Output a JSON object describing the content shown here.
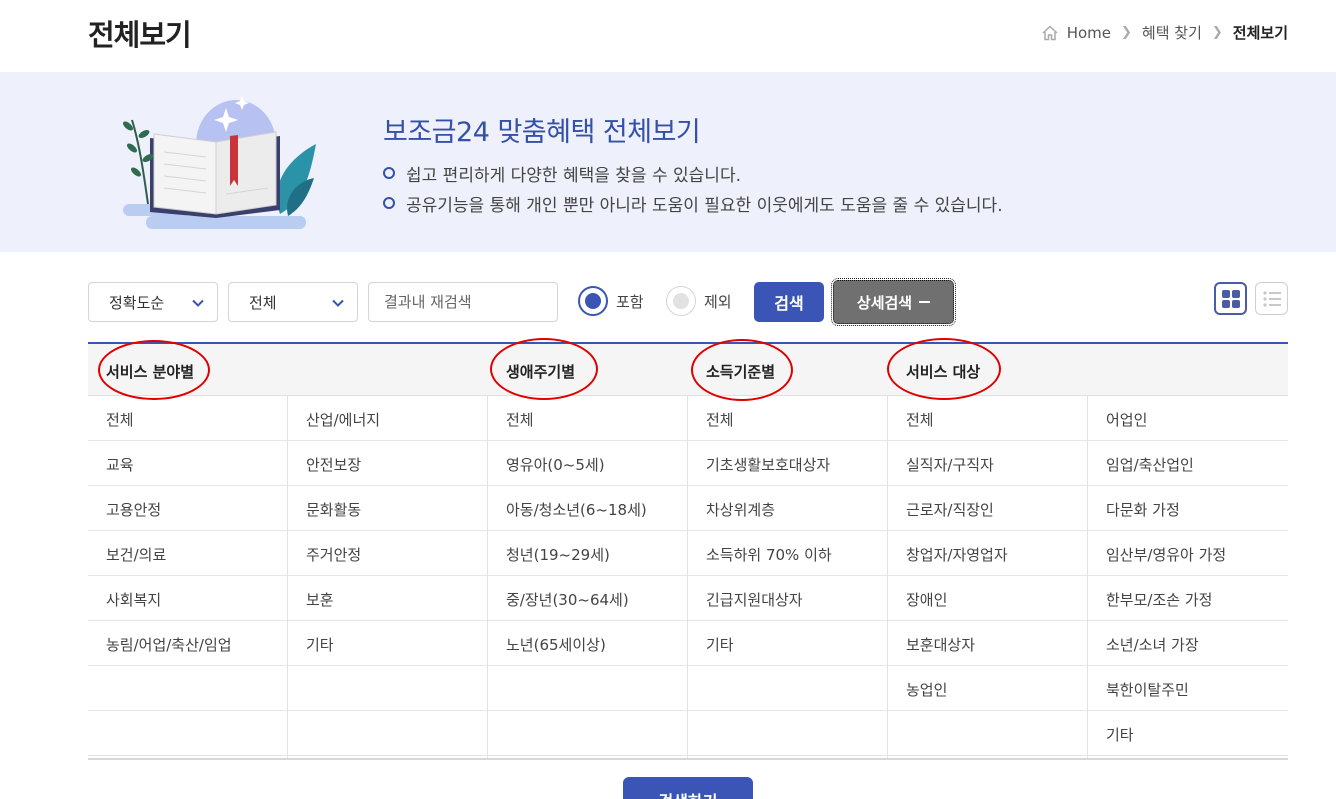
{
  "header": {
    "title": "전체보기",
    "breadcrumb": [
      "Home",
      "혜택 찾기",
      "전체보기"
    ]
  },
  "banner": {
    "title": "보조금24 맞춤혜택 전체보기",
    "bullets": [
      "쉽고 편리하게 다양한 혜택을 찾을 수 있습니다.",
      "공유기능을 통해 개인 뿐만 아니라 도움이 필요한 이웃에게도 도움을 줄 수 있습니다."
    ]
  },
  "search": {
    "sort_value": "정확도순",
    "scope_value": "전체",
    "re_search_placeholder": "결과내 재검색",
    "include_label": "포함",
    "exclude_label": "제외",
    "include_selected": true,
    "search_button": "검색",
    "detail_button": "상세검색"
  },
  "filters": {
    "headers": [
      "서비스 분야별",
      "생애주기별",
      "소득기준별",
      "서비스 대상"
    ],
    "columns": [
      [
        "전체",
        "교육",
        "고용안정",
        "보건/의료",
        "사회복지",
        "농림/어업/축산/임업",
        "",
        ""
      ],
      [
        "산업/에너지",
        "안전보장",
        "문화활동",
        "주거안정",
        "보훈",
        "기타",
        "",
        ""
      ],
      [
        "전체",
        "영유아(0~5세)",
        "아동/청소년(6~18세)",
        "청년(19~29세)",
        "중/장년(30~64세)",
        "노년(65세이상)",
        "",
        ""
      ],
      [
        "전체",
        "기초생활보호대상자",
        "차상위계층",
        "소득하위 70% 이하",
        "긴급지원대상자",
        "기타",
        "",
        ""
      ],
      [
        "전체",
        "실직자/구직자",
        "근로자/직장인",
        "창업자/자영업자",
        "장애인",
        "보훈대상자",
        "농업인",
        ""
      ],
      [
        "어업인",
        "임업/축산업인",
        "다문화 가정",
        "임산부/영유아 가정",
        "한부모/조손 가정",
        "소년/소녀 가장",
        "북한이탈주민",
        "기타"
      ]
    ]
  },
  "submit_button": "검색하기",
  "colors": {
    "accent": "#3a55b5",
    "banner_bg": "#eef1fb",
    "annotation": "#e00000"
  },
  "icons": [
    "home-icon",
    "chevron-right-icon",
    "chevron-down-icon",
    "grid-view-icon",
    "list-view-icon",
    "book-illustration"
  ]
}
